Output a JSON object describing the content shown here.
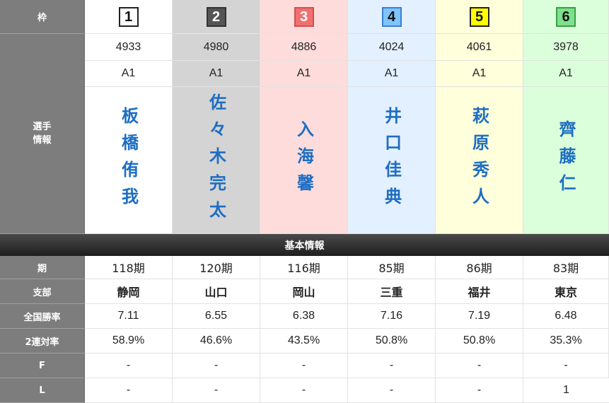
{
  "labels": {
    "waku": "枠",
    "player_info": "選手\n情報",
    "basic_info": "基本情報",
    "term": "期",
    "branch": "支部",
    "national_win_rate": "全国勝率",
    "quinella_rate": "2連対率",
    "f": "F",
    "l": "L"
  },
  "racers": [
    {
      "waku": "1",
      "reg_no": "4933",
      "grade": "A1",
      "name": "板橋侑我",
      "term": "118期",
      "branch": "静岡",
      "win_rate": "7.11",
      "quinella": "58.9%",
      "f": "-",
      "l": "-",
      "frame_color": "#ffffff"
    },
    {
      "waku": "2",
      "reg_no": "4980",
      "grade": "A1",
      "name": "佐々木完太",
      "term": "120期",
      "branch": "山口",
      "win_rate": "6.55",
      "quinella": "46.6%",
      "f": "-",
      "l": "-",
      "frame_color": "#555555"
    },
    {
      "waku": "3",
      "reg_no": "4886",
      "grade": "A1",
      "name": "入海馨",
      "term": "116期",
      "branch": "岡山",
      "win_rate": "6.38",
      "quinella": "43.5%",
      "f": "-",
      "l": "-",
      "frame_color": "#f07070"
    },
    {
      "waku": "4",
      "reg_no": "4024",
      "grade": "A1",
      "name": "井口佳典",
      "term": "85期",
      "branch": "三重",
      "win_rate": "7.16",
      "quinella": "50.8%",
      "f": "-",
      "l": "-",
      "frame_color": "#7fc4ff"
    },
    {
      "waku": "5",
      "reg_no": "4061",
      "grade": "A1",
      "name": "萩原秀人",
      "term": "86期",
      "branch": "福井",
      "win_rate": "7.19",
      "quinella": "50.8%",
      "f": "-",
      "l": "-",
      "frame_color": "#ffff00"
    },
    {
      "waku": "6",
      "reg_no": "3978",
      "grade": "A1",
      "name": "齊藤仁",
      "term": "83期",
      "branch": "東京",
      "win_rate": "6.48",
      "quinella": "35.3%",
      "f": "-",
      "l": "1",
      "frame_color": "#7ee08a"
    }
  ]
}
